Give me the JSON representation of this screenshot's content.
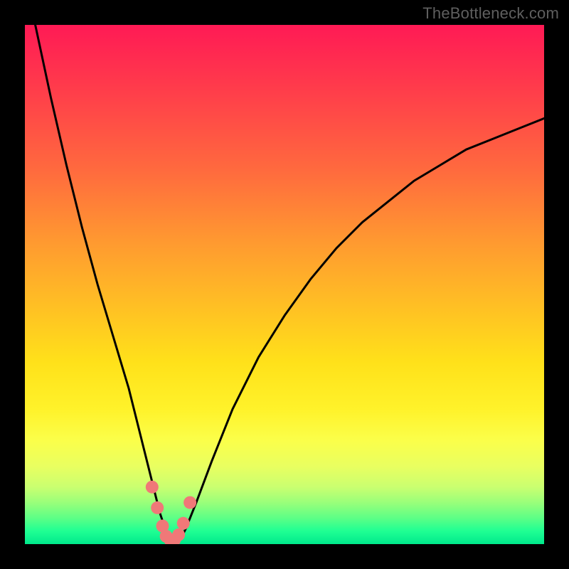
{
  "watermark": "TheBottleneck.com",
  "chart_data": {
    "type": "line",
    "title": "",
    "xlabel": "",
    "ylabel": "",
    "xlim": [
      0,
      100
    ],
    "ylim": [
      0,
      100
    ],
    "series": [
      {
        "name": "bottleneck-curve",
        "x": [
          2,
          5,
          8,
          11,
          14,
          17,
          20,
          22,
          24,
          25,
          26,
          27,
          28,
          29,
          30,
          31,
          33,
          36,
          40,
          45,
          50,
          55,
          60,
          65,
          70,
          75,
          80,
          85,
          90,
          95,
          100
        ],
        "y": [
          100,
          86,
          73,
          61,
          50,
          40,
          30,
          22,
          14,
          10,
          6,
          3,
          1,
          0.5,
          1,
          3,
          8,
          16,
          26,
          36,
          44,
          51,
          57,
          62,
          66,
          70,
          73,
          76,
          78,
          80,
          82
        ]
      }
    ],
    "markers": {
      "name": "highlight-dots",
      "color": "#f07878",
      "points": [
        {
          "x": 24.5,
          "y": 11
        },
        {
          "x": 25.5,
          "y": 7
        },
        {
          "x": 26.5,
          "y": 3.5
        },
        {
          "x": 27.2,
          "y": 1.5
        },
        {
          "x": 28.0,
          "y": 0.8
        },
        {
          "x": 28.8,
          "y": 0.8
        },
        {
          "x": 29.6,
          "y": 1.8
        },
        {
          "x": 30.5,
          "y": 4
        },
        {
          "x": 31.8,
          "y": 8
        }
      ]
    },
    "background_gradient": {
      "top": "#ff1a55",
      "bottom": "#00e98c"
    }
  }
}
